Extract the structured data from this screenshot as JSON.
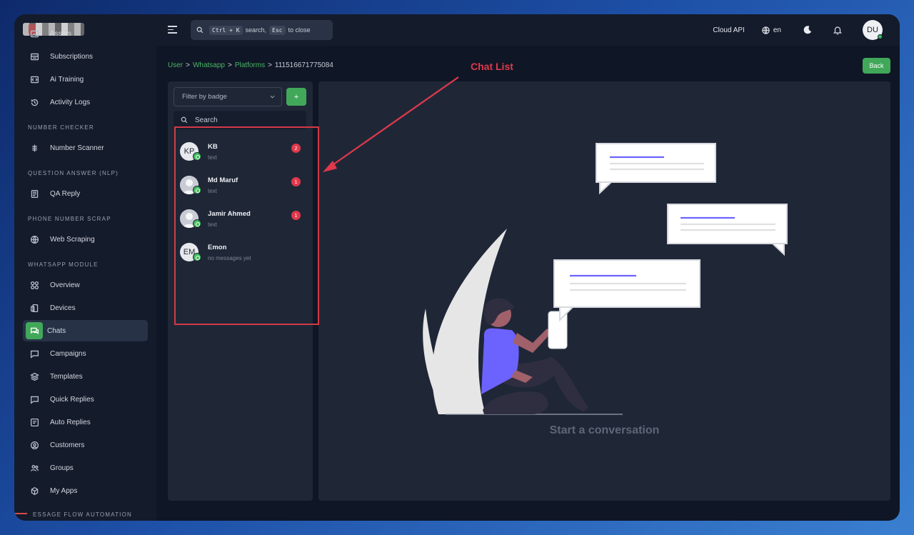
{
  "sidebar": {
    "items_top": [
      {
        "label": "Assets",
        "icon": "image-icon"
      },
      {
        "label": "Subscriptions",
        "icon": "subscriptions-icon"
      },
      {
        "label": "Ai Training",
        "icon": "code-icon"
      },
      {
        "label": "Activity Logs",
        "icon": "history-icon"
      }
    ],
    "section_number_checker": "NUMBER CHECKER",
    "number_scanner": "Number Scanner",
    "section_qa": "QUESTION ANSWER (NLP)",
    "qa_reply": "QA Reply",
    "section_scrap": "PHONE NUMBER SCRAP",
    "web_scraping": "Web Scraping",
    "section_whatsapp": "WHATSAPP MODULE",
    "whatsapp_items": [
      {
        "label": "Overview",
        "icon": "grid-icon"
      },
      {
        "label": "Devices",
        "icon": "devices-icon"
      },
      {
        "label": "Chats",
        "icon": "chats-icon",
        "active": true
      },
      {
        "label": "Campaigns",
        "icon": "campaign-icon"
      },
      {
        "label": "Templates",
        "icon": "layers-icon"
      },
      {
        "label": "Quick Replies",
        "icon": "quick-reply-icon"
      },
      {
        "label": "Auto Replies",
        "icon": "auto-reply-icon"
      },
      {
        "label": "Customers",
        "icon": "user-circle-icon"
      },
      {
        "label": "Groups",
        "icon": "users-icon"
      },
      {
        "label": "My Apps",
        "icon": "apps-icon"
      }
    ],
    "section_bottom_partial": "ESSAGE FLOW AUTOMATION"
  },
  "topbar": {
    "search_hint_key1": "Ctrl + K",
    "search_hint_text1": "search,",
    "search_hint_key2": "Esc",
    "search_hint_text2": "to close",
    "cloud_api": "Cloud API",
    "language": "en",
    "avatar_initials": "DU"
  },
  "breadcrumb": {
    "items": [
      "User",
      "Whatsapp",
      "Platforms"
    ],
    "current": "111516671775084",
    "separator": ">"
  },
  "back_label": "Back",
  "annotation": {
    "label": "Chat List",
    "color": "#e0394b"
  },
  "chat_panel": {
    "filter_placeholder": "Filter by badge",
    "add_label": "+",
    "search_placeholder": "Search",
    "chats": [
      {
        "initials": "KB",
        "avatar_text": "KP",
        "name": "KB",
        "preview": "text",
        "unread": "2",
        "avatar": "initials"
      },
      {
        "initials": "",
        "name": "Md Maruf",
        "preview": "text",
        "unread": "1",
        "avatar": "person"
      },
      {
        "initials": "",
        "name": "Jamir Ahmed",
        "preview": "text",
        "unread": "1",
        "avatar": "person"
      },
      {
        "initials": "EM",
        "avatar_text": "EM",
        "name": "Emon",
        "preview": "no messages yet",
        "unread": "",
        "avatar": "initials"
      }
    ]
  },
  "conversation": {
    "empty_text": "Start a conversation"
  },
  "colors": {
    "accent_green": "#41a85a",
    "badge_red": "#e0394b",
    "panel_bg": "#1f2737",
    "sidebar_bg": "#141b2b"
  }
}
